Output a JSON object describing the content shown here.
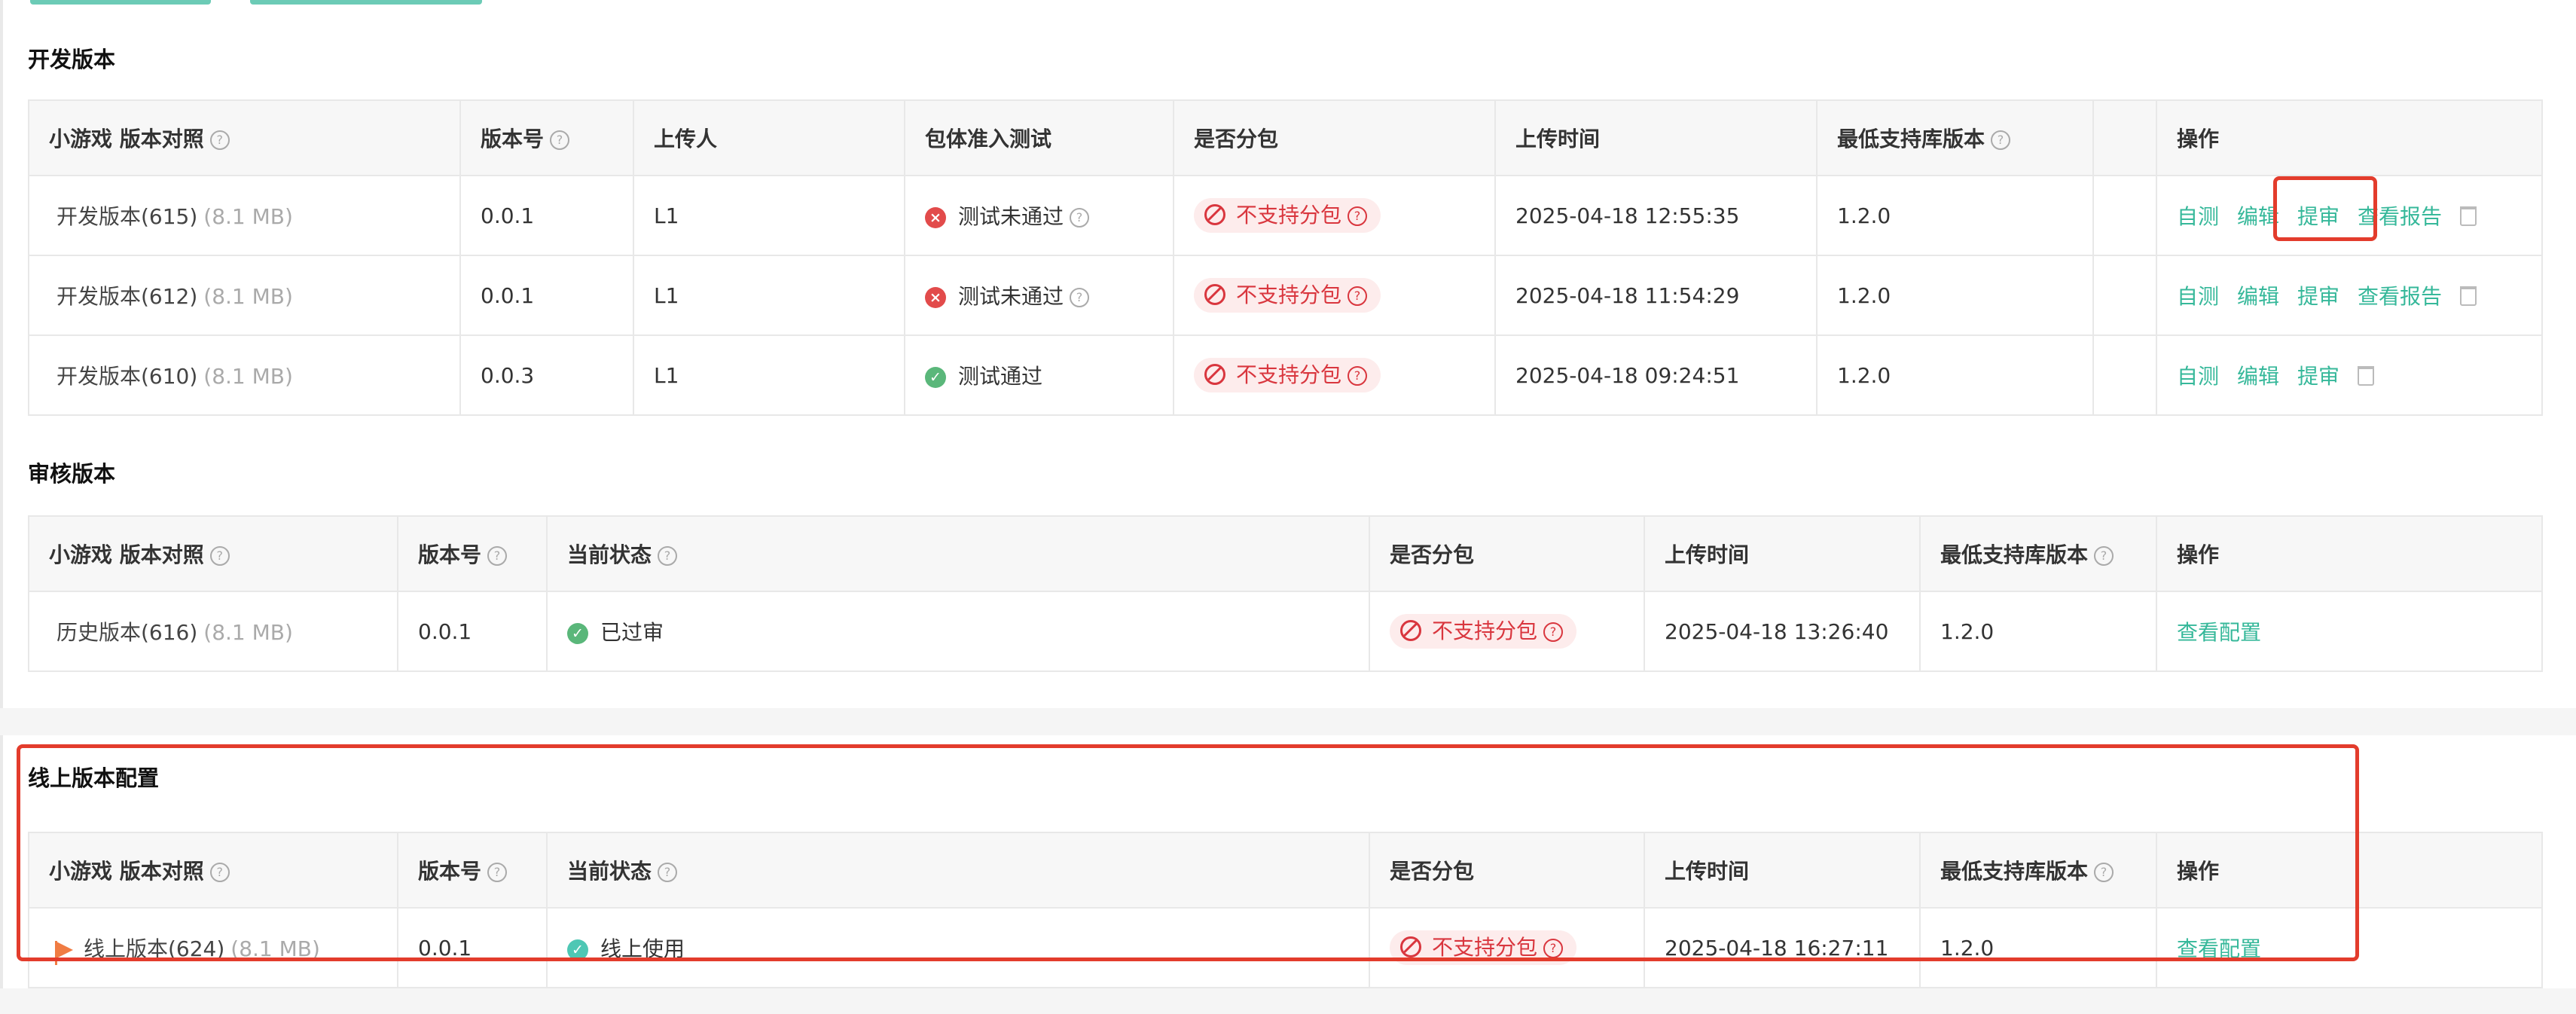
{
  "dev": {
    "title": "开发版本",
    "headers": [
      "小游戏 版本对照",
      "版本号",
      "上传人",
      "包体准入测试",
      "是否分包",
      "上传时间",
      "最低支持库版本",
      "",
      "操作"
    ],
    "rows": [
      {
        "name": "开发版本(615)",
        "size": "(8.1 MB)",
        "ver": "0.0.1",
        "uploader": "L1",
        "test": "测试未通过",
        "test_ok": false,
        "split": "不支持分包",
        "time": "2025-04-18 12:55:35",
        "lib": "1.2.0",
        "actions": [
          "自测",
          "编辑",
          "提审",
          "查看报告"
        ]
      },
      {
        "name": "开发版本(612)",
        "size": "(8.1 MB)",
        "ver": "0.0.1",
        "uploader": "L1",
        "test": "测试未通过",
        "test_ok": false,
        "split": "不支持分包",
        "time": "2025-04-18 11:54:29",
        "lib": "1.2.0",
        "actions": [
          "自测",
          "编辑",
          "提审",
          "查看报告"
        ]
      },
      {
        "name": "开发版本(610)",
        "size": "(8.1 MB)",
        "ver": "0.0.3",
        "uploader": "L1",
        "test": "测试通过",
        "test_ok": true,
        "split": "不支持分包",
        "time": "2025-04-18 09:24:51",
        "lib": "1.2.0",
        "actions": [
          "自测",
          "编辑",
          "提审"
        ]
      }
    ]
  },
  "review": {
    "title": "审核版本",
    "headers": [
      "小游戏 版本对照",
      "版本号",
      "当前状态",
      "是否分包",
      "上传时间",
      "最低支持库版本",
      "操作"
    ],
    "rows": [
      {
        "name": "历史版本(616)",
        "size": "(8.1 MB)",
        "ver": "0.0.1",
        "status": "已过审",
        "split": "不支持分包",
        "time": "2025-04-18 13:26:40",
        "lib": "1.2.0",
        "action": "查看配置"
      }
    ]
  },
  "online": {
    "title": "线上版本配置",
    "headers": [
      "小游戏 版本对照",
      "版本号",
      "当前状态",
      "是否分包",
      "上传时间",
      "最低支持库版本",
      "操作"
    ],
    "rows": [
      {
        "name": "线上版本(624)",
        "size": "(8.1 MB)",
        "ver": "0.0.1",
        "status": "线上使用",
        "split": "不支持分包",
        "time": "2025-04-18 16:27:11",
        "lib": "1.2.0",
        "action": "查看配置"
      }
    ]
  },
  "colors": {
    "accent": "#36b89a",
    "danger": "#d9363e",
    "highlight": "#e33c2c",
    "flag": "#f07c43"
  },
  "icons": {
    "help": "question-circle-icon",
    "fail": "close-circle-icon",
    "pass": "check-circle-icon",
    "ban": "ban-icon",
    "trash": "trash-icon",
    "flag": "flag-icon"
  }
}
